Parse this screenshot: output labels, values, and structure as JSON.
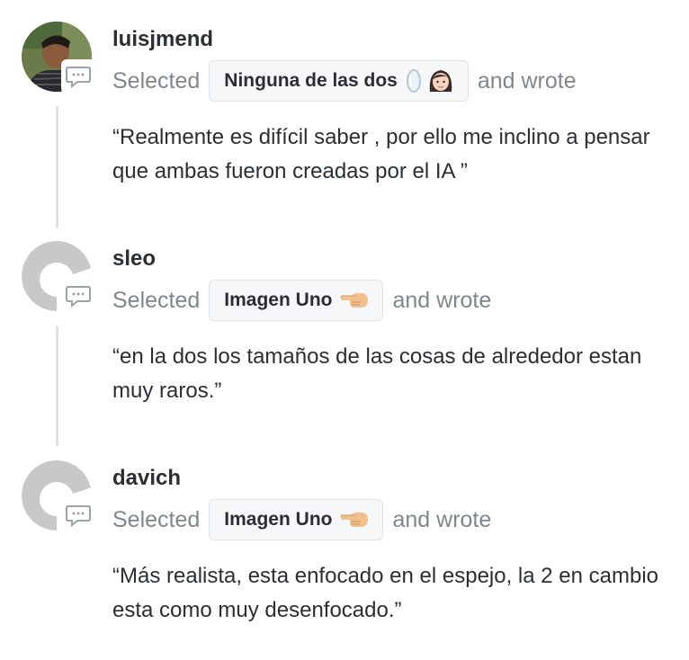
{
  "feed": {
    "entries": [
      {
        "username": "luisjmend",
        "selected_label": "Selected",
        "choice": "Ninguna de las dos",
        "choice_icons": [
          "mirror-icon",
          "woman-face-icon"
        ],
        "wrote_label": "and wrote",
        "quote": "“Realmente es difícil saber , por ello me inclino a pensar que ambas fueron creadas por el IA ”",
        "avatar": "photo-avatar"
      },
      {
        "username": "sleo",
        "selected_label": "Selected",
        "choice": "Imagen Uno",
        "choice_icons": [
          "pointing-left-hand-icon"
        ],
        "wrote_label": "and wrote",
        "quote": "“en la dos los tamaños de las cosas de alrededor estan muy raros.”",
        "avatar": "default-avatar"
      },
      {
        "username": "davich",
        "selected_label": "Selected",
        "choice": "Imagen Uno",
        "choice_icons": [
          "pointing-left-hand-icon"
        ],
        "wrote_label": "and wrote",
        "quote": "“Más realista, esta enfocado en el espejo, la 2 en cambio esta como muy desenfocado.”",
        "avatar": "default-avatar"
      }
    ]
  },
  "colors": {
    "text": "#2b2f33",
    "muted": "#7f868c",
    "chip_bg": "#f6f7f8",
    "chip_border": "#e0e3e6",
    "connector": "#dfe2e5",
    "default_avatar": "#c8c8c8"
  }
}
